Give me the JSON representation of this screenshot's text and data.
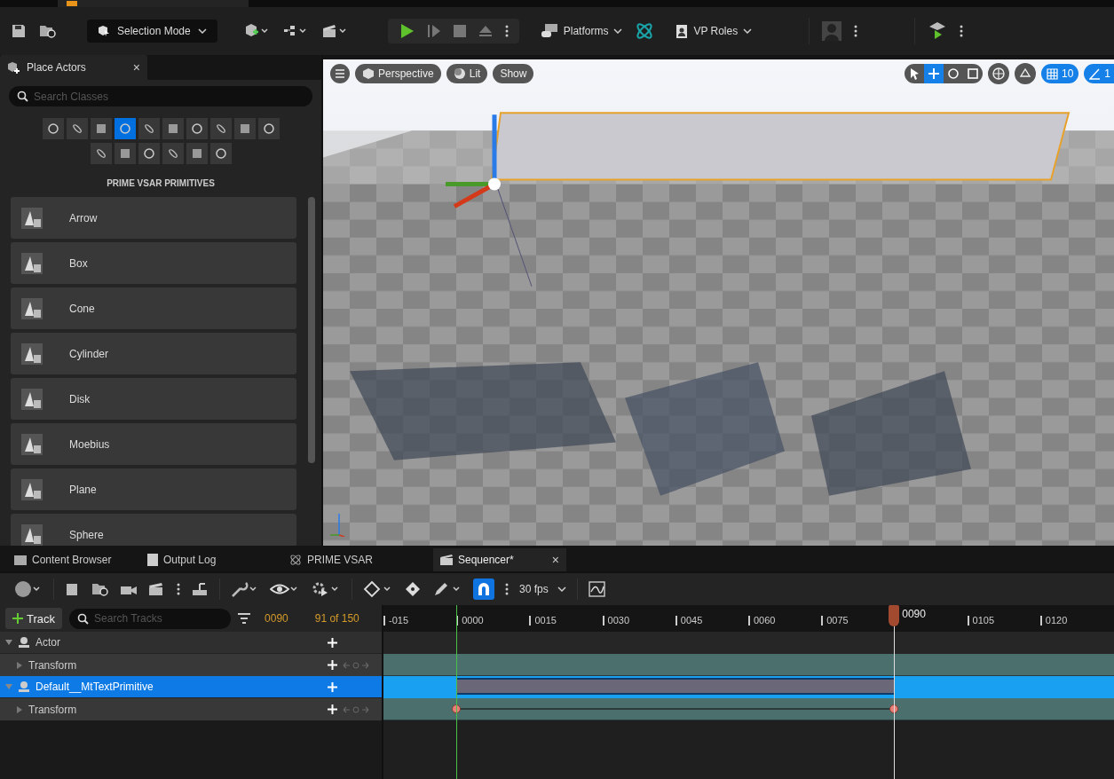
{
  "toolbar": {
    "selection_mode": "Selection Mode",
    "platforms": "Platforms",
    "vp_roles": "VP Roles"
  },
  "place_actors": {
    "tab": "Place Actors",
    "close": "×",
    "search": {
      "placeholder": "Search Classes"
    },
    "categories": [
      {
        "selected": false
      },
      {
        "selected": false
      },
      {
        "selected": false
      },
      {
        "selected": true
      },
      {
        "selected": false
      },
      {
        "selected": false
      },
      {
        "selected": false
      },
      {
        "selected": false
      },
      {
        "selected": false
      },
      {
        "selected": false
      },
      {
        "selected": false
      },
      {
        "selected": false
      },
      {
        "selected": false
      },
      {
        "selected": false
      },
      {
        "selected": false
      },
      {
        "selected": false
      }
    ],
    "heading": "PRIME VSAR PRIMITIVES",
    "items": [
      "Arrow",
      "Box",
      "Cone",
      "Cylinder",
      "Disk",
      "Moebius",
      "Plane",
      "Sphere"
    ]
  },
  "viewport": {
    "view_buttons": [
      "Perspective",
      "Lit",
      "Show"
    ],
    "transform_tools": [
      {
        "selected": false
      },
      {
        "selected": true
      },
      {
        "selected": false
      },
      {
        "selected": false
      }
    ],
    "grid_snap": {
      "value": "10",
      "on": true
    },
    "angle_snap": {
      "value": "1",
      "on": true
    }
  },
  "bottom_tabs": [
    {
      "label": "Content Browser",
      "selected": false
    },
    {
      "label": "Output Log",
      "selected": false
    },
    {
      "label": "PRIME VSAR",
      "selected": false
    },
    {
      "label": "Sequencer*",
      "selected": true,
      "close": "×"
    }
  ],
  "sequencer": {
    "snap": {
      "on": true
    },
    "fps": "30 fps",
    "add_track": "Track",
    "search": {
      "placeholder": "Search Tracks"
    },
    "current_frame": "0090",
    "frame_count": "91 of 150",
    "tracks": [
      {
        "label": "Actor",
        "selected": false,
        "children": [
          {
            "label": "Transform",
            "selected": false,
            "keyed": false
          }
        ]
      },
      {
        "label": "Default__MtTextPrimitive",
        "selected": true,
        "children": [
          {
            "label": "Transform",
            "selected": false,
            "keyed": true
          }
        ]
      }
    ],
    "ruler": {
      "ticks": [
        "-015",
        "0000",
        "0015",
        "0030",
        "0045",
        "0060",
        "0075",
        "0105",
        "0120"
      ]
    },
    "playhead": {
      "label": "0090",
      "level": 0.699
    }
  }
}
